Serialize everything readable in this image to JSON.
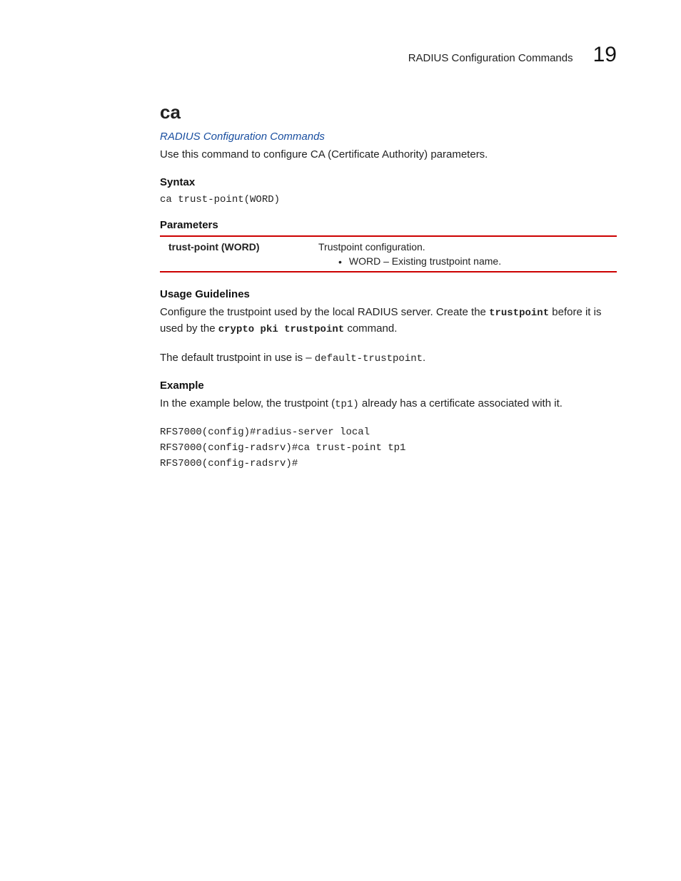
{
  "header": {
    "section_title": "RADIUS Configuration Commands",
    "chapter_number": "19"
  },
  "command": {
    "name": "ca",
    "link_text": "RADIUS Configuration Commands",
    "intro": "Use this command to configure CA (Certificate Authority) parameters."
  },
  "syntax": {
    "heading": "Syntax",
    "code": "ca trust-point(WORD)"
  },
  "parameters": {
    "heading": "Parameters",
    "row": {
      "name": "trust-point (WORD)",
      "desc": "Trustpoint configuration.",
      "bullet": "WORD – Existing trustpoint name."
    }
  },
  "usage": {
    "heading": "Usage Guidelines",
    "p1_a": "Configure the trustpoint used by the local RADIUS server. Create the ",
    "p1_kw1": "trustpoint",
    "p1_b": " before it is used by the ",
    "p1_kw2": "crypto pki trustpoint",
    "p1_c": " command.",
    "p2_a": "The default trustpoint in use is – ",
    "p2_code": "default-trustpoint",
    "p2_b": "."
  },
  "example": {
    "heading": "Example",
    "intro_a": "In the example below, the trustpoint (",
    "intro_code": "tp1)",
    "intro_b": "  already has a certificate associated with it.",
    "code": "RFS7000(config)#radius-server local\nRFS7000(config-radsrv)#ca trust-point tp1\nRFS7000(config-radsrv)#"
  }
}
